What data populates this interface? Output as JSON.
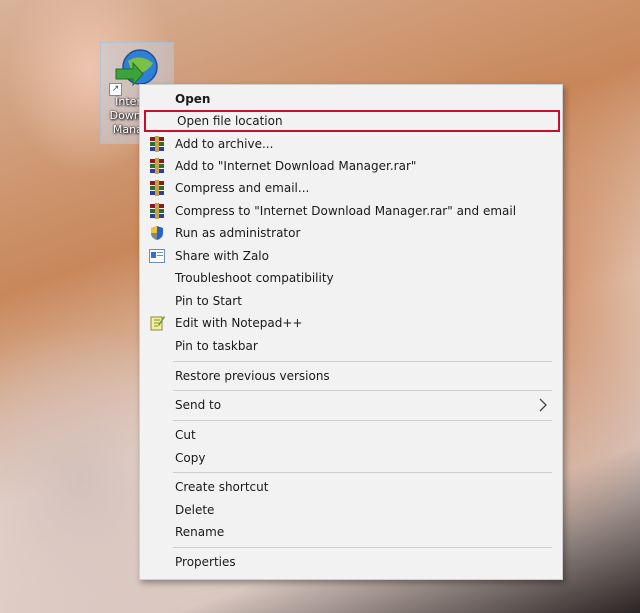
{
  "desktop": {
    "shortcut_label": "Internet\nDownload\nManager",
    "shortcut_arrow": "↗"
  },
  "menu": {
    "items": [
      {
        "label": "Open",
        "bold": true,
        "icon": ""
      },
      {
        "label": "Open file location",
        "highlighted": true,
        "icon": ""
      },
      {
        "label": "Add to archive...",
        "icon": "winrar-icon"
      },
      {
        "label": "Add to \"Internet Download Manager.rar\"",
        "icon": "winrar-icon"
      },
      {
        "label": "Compress and email...",
        "icon": "winrar-icon"
      },
      {
        "label": "Compress to \"Internet Download Manager.rar\" and email",
        "icon": "winrar-icon"
      },
      {
        "label": "Run as administrator",
        "icon": "shield-icon"
      },
      {
        "label": "Share with Zalo",
        "icon": "zalo-icon"
      },
      {
        "label": "Troubleshoot compatibility",
        "icon": ""
      },
      {
        "label": "Pin to Start",
        "icon": ""
      },
      {
        "label": "Edit with Notepad++",
        "icon": "notepad-plus-plus-icon"
      },
      {
        "label": "Pin to taskbar",
        "icon": ""
      },
      {
        "label": "Restore previous versions",
        "icon": ""
      },
      {
        "label": "Send to",
        "icon": "",
        "submenu": true
      },
      {
        "label": "Cut",
        "icon": ""
      },
      {
        "label": "Copy",
        "icon": ""
      },
      {
        "label": "Create shortcut",
        "icon": ""
      },
      {
        "label": "Delete",
        "icon": ""
      },
      {
        "label": "Rename",
        "icon": ""
      },
      {
        "label": "Properties",
        "icon": ""
      }
    ]
  },
  "colors": {
    "highlight_border": "#c8102e",
    "menu_background": "#f2f2f2"
  }
}
